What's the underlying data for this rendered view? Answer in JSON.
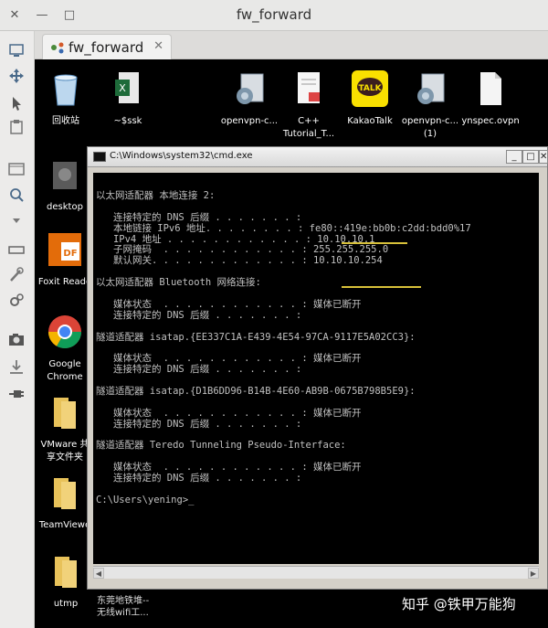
{
  "window": {
    "title": "fw_forward",
    "controls": {
      "close": "✕",
      "minimize": "—",
      "maximize": "□"
    }
  },
  "tab": {
    "label": "fw_forward",
    "close": "✕"
  },
  "toolbar": {
    "icons": [
      "monitor-icon",
      "move-icon",
      "cursor-icon",
      "clipboard-icon",
      "window-icon",
      "search-zoom-icon",
      "dropdown-icon",
      "keyboard-icon",
      "settings-icon",
      "gears-icon",
      "camera-icon",
      "download-icon",
      "plug-icon"
    ]
  },
  "desktop_icons": [
    {
      "name": "recycle-bin",
      "label": "回收站",
      "color": "#5aa0d8"
    },
    {
      "name": "excel-file",
      "label": "~$ssk",
      "color": "#1e6b3a"
    },
    {
      "name": "openvpn-installer-1",
      "label": "openvpn-c...",
      "color": "#6f8fa8"
    },
    {
      "name": "cpp-tutorial-pdf",
      "label": "C++\nTutorial_T...",
      "color": "#f2f2f2"
    },
    {
      "name": "kakaotalk",
      "label": "KakaoTalk",
      "color": "#f9e000"
    },
    {
      "name": "openvpn-installer-2",
      "label": "openvpn-c...\n(1)",
      "color": "#6f8fa8"
    },
    {
      "name": "ynspec-ovpn",
      "label": "ynspec.ovpn",
      "color": "#f4f4f4"
    },
    {
      "name": "desktop-folder",
      "label": "desktop",
      "color": "#666"
    },
    {
      "name": "foxit-reader",
      "label": "Foxit Reade",
      "color": "#e36c0a"
    },
    {
      "name": "google-chrome",
      "label": "Google\nChrome",
      "color": "#db4437"
    },
    {
      "name": "vmware-share",
      "label": "VMware 共\n享文件夹",
      "color": "#e8c25a"
    },
    {
      "name": "teamviewer-folder",
      "label": "TeamViewe",
      "color": "#e8c25a"
    },
    {
      "name": "utmp-folder",
      "label": "utmp",
      "color": "#e8c25a"
    }
  ],
  "cmd": {
    "title": "C:\\Windows\\system32\\cmd.exe",
    "buttons": {
      "minimize": "_",
      "maximize": "□",
      "close": "✕"
    },
    "lines": [
      "以太网适配器 本地连接 2:",
      "",
      "   连接特定的 DNS 后缀 . . . . . . . :",
      "   本地链接 IPv6 地址. . . . . . . . : fe80::419e:bb0b:c2dd:bdd0%17",
      "   IPv4 地址 . . . . . . . . . . . . : 10.10.10.1",
      "   子网掩码  . . . . . . . . . . . . : 255.255.255.0",
      "   默认网关. . . . . . . . . . . . . : 10.10.10.254",
      "",
      "以太网适配器 Bluetooth 网络连接:",
      "",
      "   媒体状态  . . . . . . . . . . . . : 媒体已断开",
      "   连接特定的 DNS 后缀 . . . . . . . :",
      "",
      "隧道适配器 isatap.{EE337C1A-E439-4E54-97CA-9117E5A02CC3}:",
      "",
      "   媒体状态  . . . . . . . . . . . . : 媒体已断开",
      "   连接特定的 DNS 后缀 . . . . . . . :",
      "",
      "隧道适配器 isatap.{D1B6DD96-B14B-4E60-AB9B-0675B798B5E9}:",
      "",
      "   媒体状态  . . . . . . . . . . . . : 媒体已断开",
      "   连接特定的 DNS 后缀 . . . . . . . :",
      "",
      "隧道适配器 Teredo Tunneling Pseudo-Interface:",
      "",
      "   媒体状态  . . . . . . . . . . . . : 媒体已断开",
      "   连接特定的 DNS 后缀 . . . . . . . :",
      "",
      "C:\\Users\\yening>_"
    ]
  },
  "taskbar_hint": "东莞地铁堆--\n无线wifi工...",
  "watermark": "知乎 @铁甲万能狗",
  "colors": {
    "highlight_underline": "#d8c13a",
    "cmd_text": "#c0c0c0"
  }
}
